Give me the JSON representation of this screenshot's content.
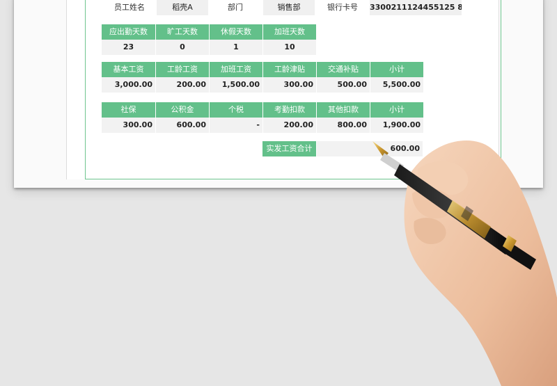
{
  "info": {
    "name_label": "员工姓名",
    "name_value": "稻壳A",
    "dept_label": "部门",
    "dept_value": "销售部",
    "bank_label": "银行卡号",
    "bank_value": "3300211124455125 8"
  },
  "attendance": {
    "headers": [
      "应出勤天数",
      "旷工天数",
      "休假天数",
      "加班天数"
    ],
    "values": [
      "23",
      "0",
      "1",
      "10"
    ]
  },
  "income": {
    "headers": [
      "基本工资",
      "工龄工资",
      "加班工资",
      "工龄津贴",
      "交通补贴",
      "小计"
    ],
    "values": [
      "3,000.00",
      "200.00",
      "1,500.00",
      "300.00",
      "500.00",
      "5,500.00"
    ]
  },
  "deduction": {
    "headers": [
      "社保",
      "公积金",
      "个税",
      "考勤扣款",
      "其他扣款",
      "小计"
    ],
    "values": [
      "300.00",
      "600.00",
      "-",
      "200.00",
      "800.00",
      "1,900.00"
    ]
  },
  "total": {
    "label": "实发工资合计",
    "value": "600.00"
  },
  "colors": {
    "header_green": "#63c08a",
    "border_green": "#6ec58f"
  }
}
